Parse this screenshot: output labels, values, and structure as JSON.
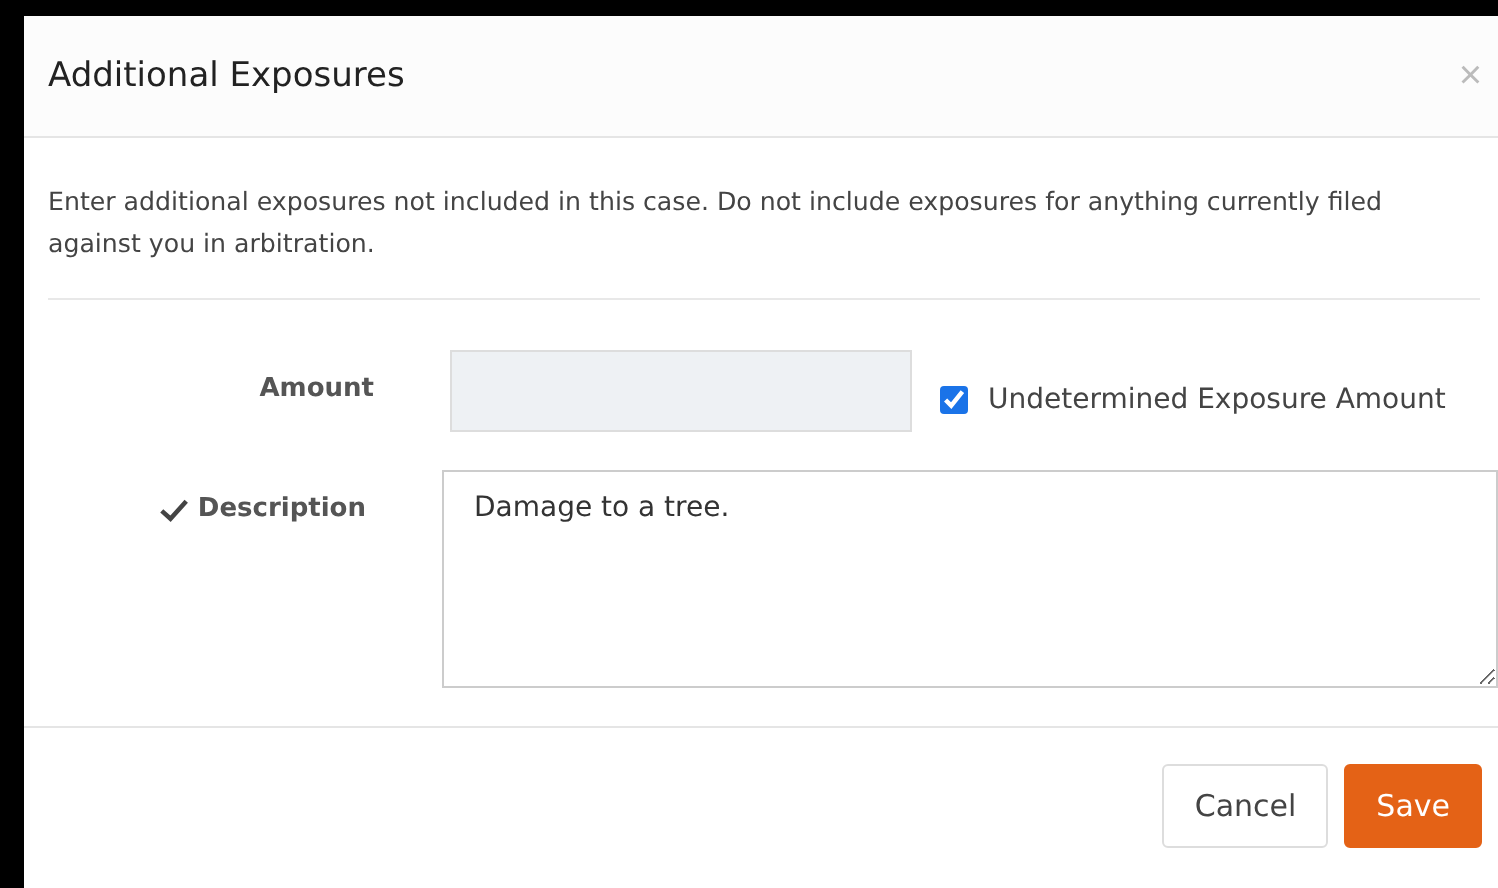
{
  "dialog": {
    "title": "Additional Exposures",
    "close": "×"
  },
  "intro": "Enter additional exposures not included in this case. Do not include exposures for anything currently filed against you in arbitration.",
  "fields": [
    {
      "kind": "amount",
      "label": "Amount",
      "valid": false,
      "disabled": true,
      "checkbox": {
        "label": "Undetermined Exposure Amount",
        "checked": true
      }
    },
    {
      "kind": "textarea",
      "label": "Description",
      "valid": true,
      "disabled": false,
      "value": "Damage to a tree."
    }
  ],
  "buttons": [
    {
      "label": "Cancel",
      "kind": "secondary"
    },
    {
      "label": "Save",
      "kind": "primary"
    }
  ]
}
